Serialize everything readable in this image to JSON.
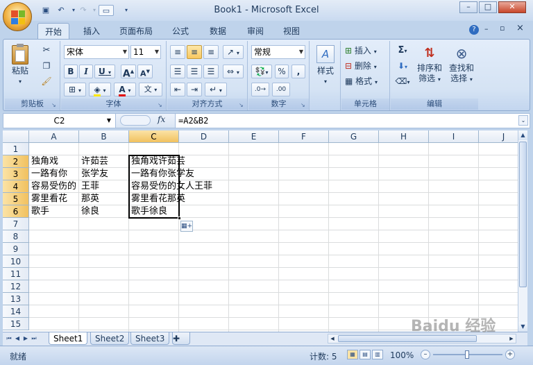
{
  "window": {
    "title": "Book1 - Microsoft Excel",
    "minimize": "–",
    "restore": "□",
    "close": "✕",
    "doc_minimize": "–",
    "doc_restore": "▫",
    "doc_close": "×",
    "help": "?"
  },
  "qat": {
    "save_icon": "save-icon",
    "undo_icon": "undo-icon",
    "redo_icon": "redo-icon",
    "customize_icon": "customize-qat-icon"
  },
  "tabs": [
    {
      "label": "开始",
      "active": true
    },
    {
      "label": "插入"
    },
    {
      "label": "页面布局"
    },
    {
      "label": "公式"
    },
    {
      "label": "数据"
    },
    {
      "label": "审阅"
    },
    {
      "label": "视图"
    }
  ],
  "ribbon": {
    "clipboard": {
      "title": "剪贴板",
      "paste": "粘贴"
    },
    "font": {
      "title": "字体",
      "name": "宋体",
      "size": "11",
      "bold": "B",
      "italic": "I",
      "underline": "U",
      "grow": "A",
      "shrink": "A",
      "wen": "文"
    },
    "alignment": {
      "title": "对齐方式"
    },
    "number": {
      "title": "数字",
      "format": "常规",
      "percent": "%",
      "comma": ","
    },
    "styles": {
      "label": "样式"
    },
    "cells": {
      "title": "单元格",
      "insert": "插入",
      "delete": "删除",
      "format": "格式"
    },
    "editing": {
      "title": "编辑",
      "sort": "排序和",
      "sort2": "筛选",
      "find": "查找和",
      "find2": "选择",
      "sigma": "Σ"
    }
  },
  "formula_bar": {
    "name_box": "C2",
    "fx": "fx",
    "formula": "=A2&B2"
  },
  "columns": [
    "A",
    "B",
    "C",
    "D",
    "E",
    "F",
    "G",
    "H",
    "I",
    "J"
  ],
  "selected_column": "C",
  "rows": [
    "1",
    "2",
    "3",
    "4",
    "5",
    "6",
    "7",
    "8",
    "9",
    "10",
    "11",
    "12",
    "13",
    "14",
    "15"
  ],
  "selected_rows": [
    "2",
    "3",
    "4",
    "5",
    "6"
  ],
  "cells": {
    "A2": "独角戏",
    "B2": "许茹芸",
    "C2": "独角戏许茹芸",
    "A3": "一路有你",
    "B3": "张学友",
    "C3": "一路有你张学友",
    "A4": "容易受伤的",
    "B4": "王菲",
    "C4": "容易受伤的女人王菲",
    "A5": "雾里看花",
    "B5": "那英",
    "C5": "雾里看花那英",
    "A6": "歌手",
    "B6": "徐良",
    "C6": "歌手徐良"
  },
  "sheets": [
    {
      "name": "Sheet1",
      "active": true
    },
    {
      "name": "Sheet2"
    },
    {
      "name": "Sheet3"
    }
  ],
  "status": {
    "ready": "就绪",
    "count_label": "计数: 5",
    "zoom": "100%",
    "zoom_out": "–",
    "zoom_in": "+"
  },
  "watermark": "Baidu 经验"
}
